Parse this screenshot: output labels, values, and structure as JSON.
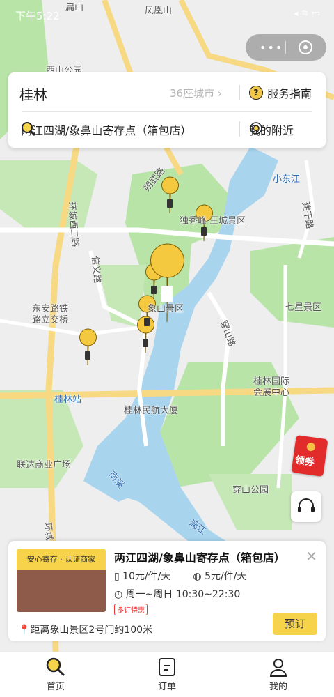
{
  "status_bar": {
    "time": "下午5:22",
    "icons": "◂ ≋ ▭"
  },
  "map_labels": [
    {
      "text": "扁山",
      "cls": "lbl"
    },
    {
      "text": "凤凰山",
      "cls": "lbl"
    },
    {
      "text": "西山公园",
      "cls": "lbl"
    },
    {
      "text": "小东江",
      "cls": "lbl blue"
    },
    {
      "text": "建干路",
      "cls": "lbl"
    },
    {
      "text": "朔武路",
      "cls": "lbl"
    },
    {
      "text": "独秀峰·王城景区",
      "cls": "lbl"
    },
    {
      "text": "环城西二路",
      "cls": "lbl"
    },
    {
      "text": "信义路",
      "cls": "lbl"
    },
    {
      "text": "七星景区",
      "cls": "lbl"
    },
    {
      "text": "东安路铁路立交桥",
      "cls": "lbl"
    },
    {
      "text": "穿山路",
      "cls": "lbl"
    },
    {
      "text": "桂林国际会展中心",
      "cls": "lbl"
    },
    {
      "text": "桂林站",
      "cls": "lbl blue"
    },
    {
      "text": "桂林民航大厦",
      "cls": "lbl"
    },
    {
      "text": "联达商业广场",
      "cls": "lbl"
    },
    {
      "text": "南溪",
      "cls": "lbl blue"
    },
    {
      "text": "穿山公园",
      "cls": "lbl"
    },
    {
      "text": "漓江",
      "cls": "lbl blue"
    },
    {
      "text": "环城西",
      "cls": "lbl"
    },
    {
      "text": "象山景区",
      "cls": "lbl"
    }
  ],
  "search": {
    "city": "桂林",
    "city_count": "36座城市",
    "guide_label": "服务指南",
    "query": "两江四湖/象鼻山寄存点（箱包店）",
    "nearby_label": "我的附近"
  },
  "coupon_label": "领券",
  "store": {
    "tag": "安心寄存 · 认证商家",
    "title": "两江四湖/象鼻山寄存点（箱包店）",
    "price_large": "10元/件/天",
    "price_small": "5元/件/天",
    "hours": "周一~周日 10:30~22:30",
    "badge": "多订特惠",
    "distance": "距离象山景区2号门约100米",
    "book_label": "预订"
  },
  "tabs": [
    {
      "label": "首页"
    },
    {
      "label": "订单"
    },
    {
      "label": "我的"
    }
  ],
  "colors": {
    "accent": "#f5d34a",
    "water": "#a8d4ee",
    "park": "#b9e4a8",
    "road": "#ffffff",
    "main_road": "#f7d983"
  }
}
